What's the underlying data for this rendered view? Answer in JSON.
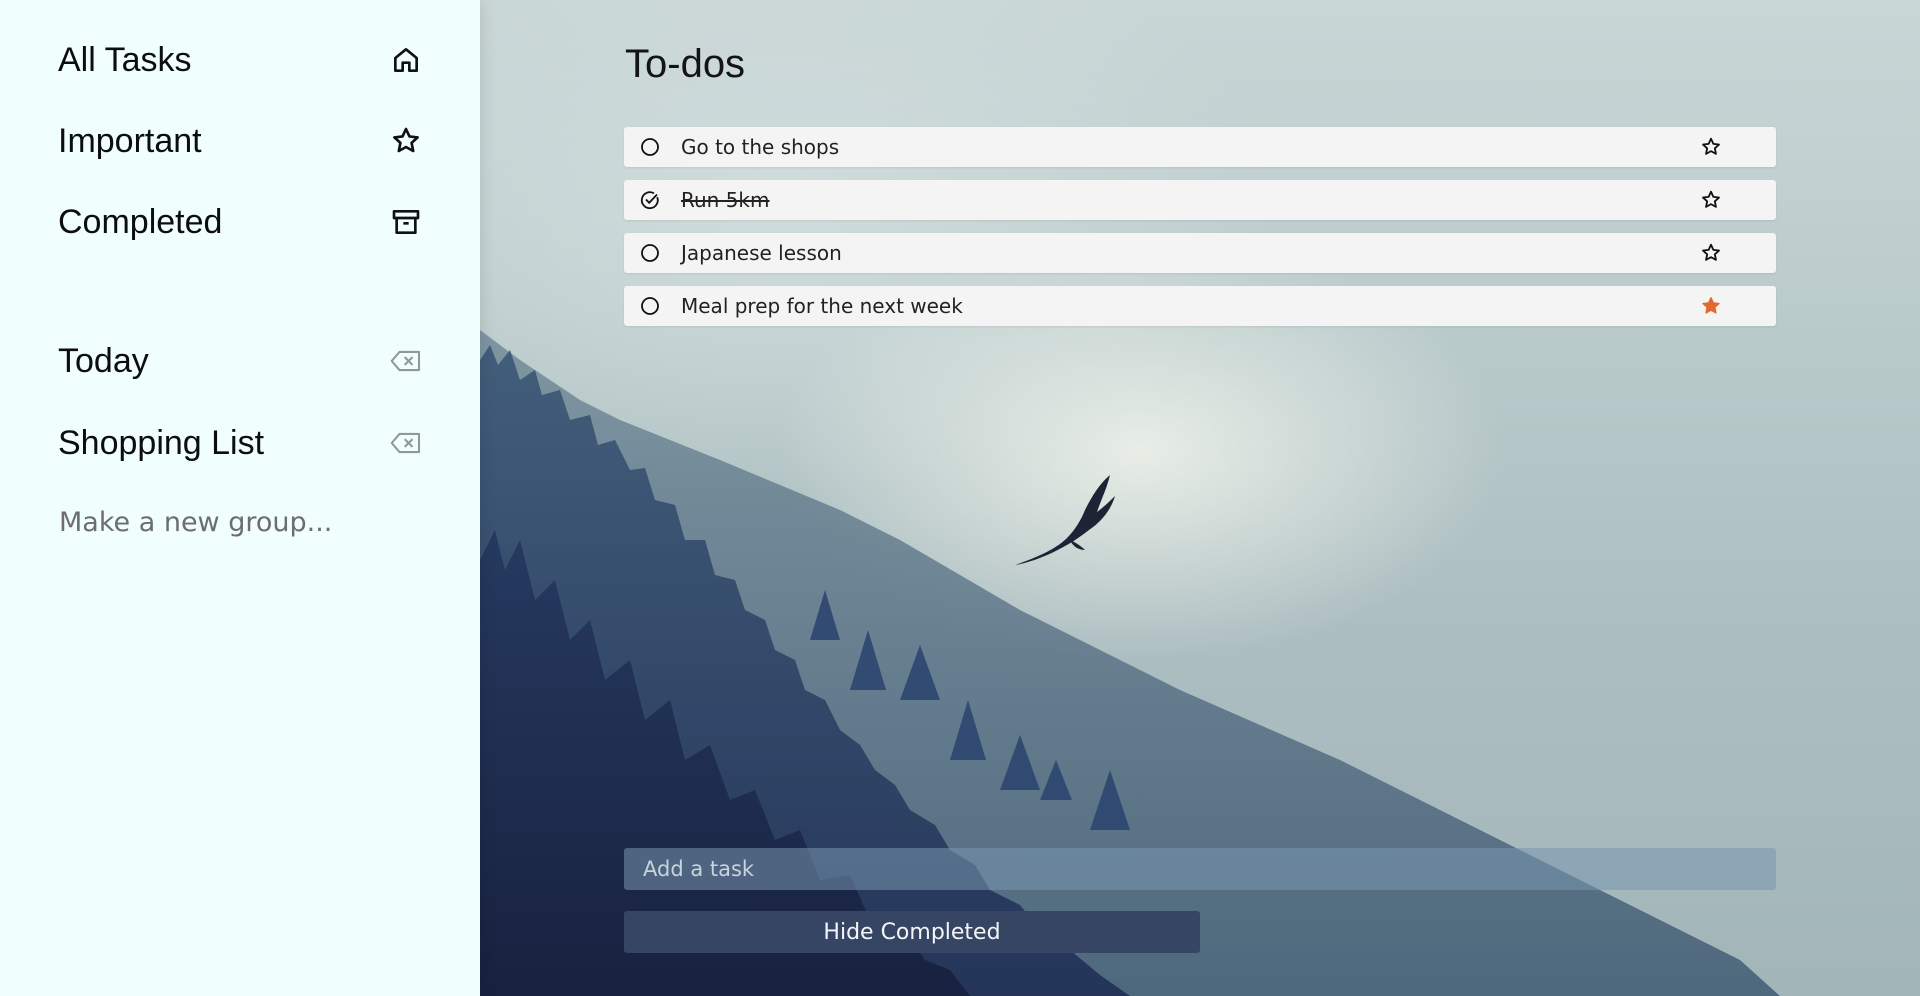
{
  "sidebar": {
    "nav": [
      {
        "label": "All Tasks",
        "icon": "home-icon"
      },
      {
        "label": "Important",
        "icon": "star-outline-icon"
      },
      {
        "label": "Completed",
        "icon": "archive-icon"
      }
    ],
    "groups": [
      {
        "label": "Today",
        "icon": "backspace-delete-icon"
      },
      {
        "label": "Shopping List",
        "icon": "backspace-delete-icon"
      }
    ],
    "new_group_placeholder": "Make a new group..."
  },
  "main": {
    "title": "To-dos",
    "tasks": [
      {
        "text": "Go to the shops",
        "completed": false,
        "important": false
      },
      {
        "text": "Run 5km",
        "completed": true,
        "important": false
      },
      {
        "text": "Japanese lesson",
        "completed": false,
        "important": false
      },
      {
        "text": "Meal prep for the next week",
        "completed": false,
        "important": true
      }
    ],
    "add_task_placeholder": "Add a task",
    "hide_completed_label": "Hide Completed"
  },
  "colors": {
    "sidebar_bg": "#f0fffe",
    "important_star": "#e2682c",
    "button_bg": "#354563"
  }
}
